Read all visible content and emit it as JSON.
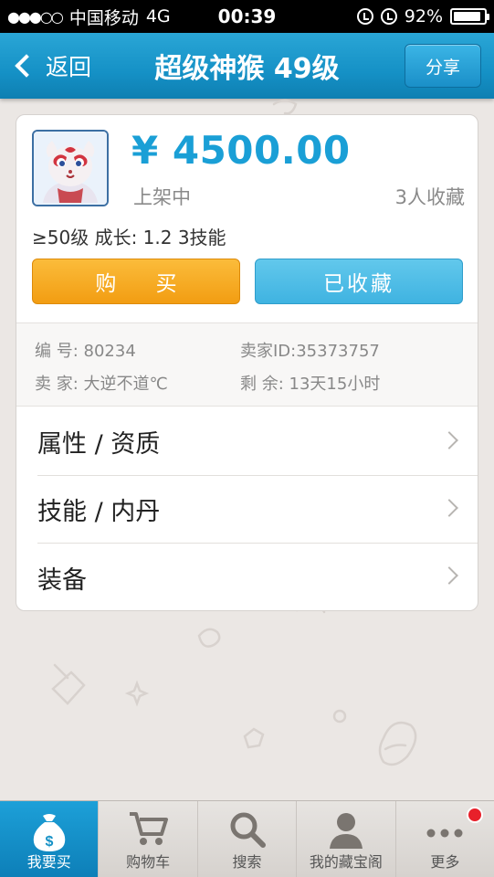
{
  "status_bar": {
    "signal": "●●●○○",
    "carrier": "中国移动",
    "network": "4G",
    "time": "00:39",
    "battery_percent": "92%",
    "battery_level": 0.92
  },
  "nav": {
    "back_label": "返回",
    "title": "超级神猴 49级",
    "share_label": "分享"
  },
  "product": {
    "price": "¥ 4500.00",
    "status": "上架中",
    "favorites": "3人收藏",
    "specs": "≥50级 成长: 1.2  3技能",
    "buy_label": "购 买",
    "fav_label": "已收藏"
  },
  "info": {
    "number_label": "编  号: 80234",
    "seller_id_label": "卖家ID:35373757",
    "seller_label": "卖  家: 大逆不道℃",
    "remaining_label": "剩  余: 13天15小时"
  },
  "menu": [
    {
      "label": "属性 / 资质"
    },
    {
      "label": "技能 / 内丹"
    },
    {
      "label": "装备"
    }
  ],
  "tabs": [
    {
      "label": "我要买",
      "icon": "money-bag-icon",
      "active": true
    },
    {
      "label": "购物车",
      "icon": "cart-icon",
      "active": false
    },
    {
      "label": "搜索",
      "icon": "search-icon",
      "active": false
    },
    {
      "label": "我的藏宝阁",
      "icon": "user-icon",
      "active": false
    },
    {
      "label": "更多",
      "icon": "more-icon",
      "active": false
    }
  ],
  "colors": {
    "accent": "#1591c6",
    "price": "#1a9fd6",
    "buy": "#f29d12",
    "favorite": "#3fb3e1",
    "badge": "#e8202a"
  }
}
